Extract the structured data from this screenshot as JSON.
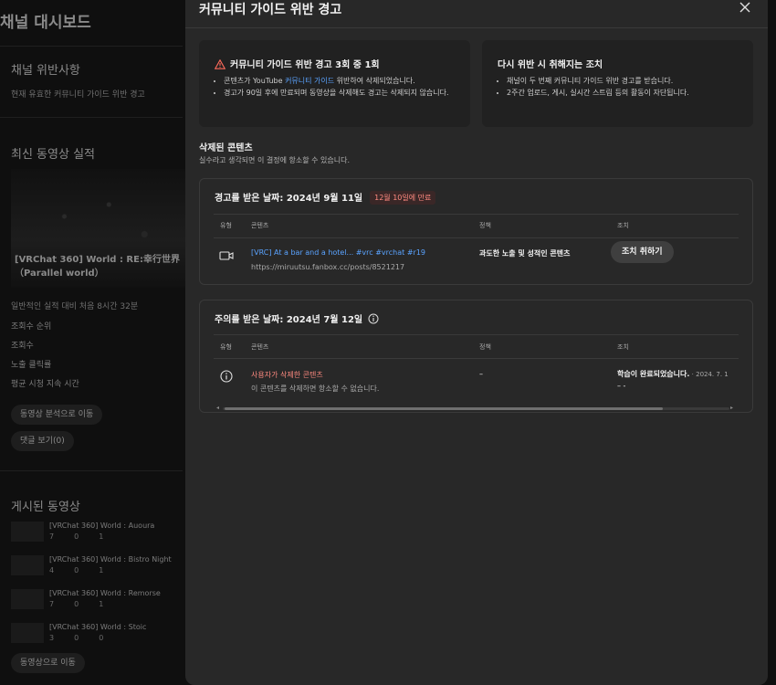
{
  "dashboard": {
    "title": "채널 대시보드",
    "violations": {
      "heading": "채널 위반사항",
      "text": "현재 유효한 커뮤니티 가이드 위반 경고"
    },
    "latest": {
      "heading": "최신 동영상 실적",
      "video_title": "[VRChat 360] World : RE:幸行世界（Parallel world）",
      "compare_text": "일반적인 실적 대비 처음 8시간 32분",
      "metrics": [
        "조회수 순위",
        "조회수",
        "노출 클릭률",
        "평균 시청 지속 시간"
      ],
      "analysis_button": "동영상 분석으로 이동",
      "comments_button": "댓글 보기(0)"
    },
    "published": {
      "heading": "게시된 동영상",
      "items": [
        {
          "title": "[VRChat 360] World : Auoura",
          "likes": "7",
          "comments": "0",
          "shares": "1"
        },
        {
          "title": "[VRChat 360] World : Bistro Night",
          "likes": "4",
          "comments": "0",
          "shares": "1"
        },
        {
          "title": "[VRChat 360] World : Remorse",
          "likes": "7",
          "comments": "0",
          "shares": "1"
        },
        {
          "title": "[VRChat 360] World : Stoic",
          "likes": "3",
          "comments": "0",
          "shares": "0"
        }
      ],
      "go_button": "동영상으로 이동"
    }
  },
  "modal": {
    "title": "커뮤니티 가이드 위반 경고",
    "left_card": {
      "title": "커뮤니티 가이드 위반 경고 3회 중 1회",
      "bullet1_pre": "콘텐츠가 YouTube ",
      "bullet1_link": "커뮤니티 가이드",
      "bullet1_post": " 위반하여 삭제되었습니다.",
      "bullet2": "경고가 90일 후에 만료되며 동영상을 삭제해도 경고는 삭제되지 않습니다."
    },
    "right_card": {
      "title": "다시 위반 시 취해지는 조치",
      "bullet1": "채널이 두 번째 커뮤니티 가이드 위반 경고를 받습니다.",
      "bullet2": "2주간 업로드, 게시, 실시간 스트림 등의 활동이 자단됩니다."
    },
    "removed": {
      "title": "삭제된 콘텐츠",
      "subtitle": "실수라고 생각되면 이 결정에 항소할 수 있습니다."
    },
    "strike_box": {
      "heading": "경고를 받은 날짜: 2024년 9월 11일",
      "expire": "12월 10일에 만료",
      "columns": [
        "유형",
        "콘텐츠",
        "정책",
        "조치"
      ],
      "content_title": "[VRC] At a bar and a hotel... #vrc #vrchat #r19",
      "content_url": "https://miruutsu.fanbox.cc/posts/8521217",
      "policy": "과도한 노출 및 성적인 콘텐츠",
      "action_button": "조치 취하기"
    },
    "warning_box": {
      "heading": "주의를 받은 날짜: 2024년 7월 12일",
      "columns": [
        "유형",
        "콘텐츠",
        "정책",
        "조치"
      ],
      "content_title": "사용자가 삭제한 콘텐츠",
      "content_sub": "이 콘텐츠를 삭제하면 항소할 수 없습니다.",
      "policy": "–",
      "action_bold": "학습이 완료되었습니다.",
      "action_rest": " · 2024. 7. 1",
      "action_line2": "– -"
    }
  },
  "colors": {
    "modal_bg": "#282828",
    "card_bg": "#212121",
    "link": "#5aa3ff",
    "danger": "#ff8a80"
  }
}
